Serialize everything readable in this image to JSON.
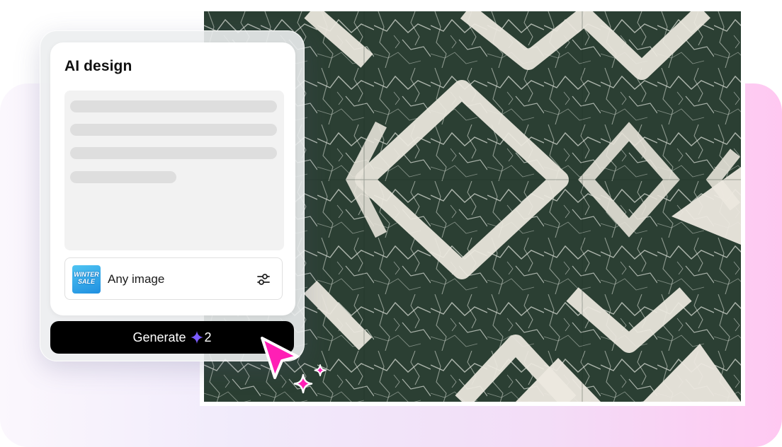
{
  "panel": {
    "title": "AI design",
    "prompt_placeholder_lines": 4,
    "image_option": {
      "thumbnail_text": "WINTER SALE",
      "label": "Any image",
      "settings_icon": "sliders-icon"
    },
    "generate_button": {
      "label": "Generate",
      "credit_icon": "sparkle-icon",
      "credit_count": "2"
    }
  },
  "preview": {
    "description_icon": "marble-pattern-image"
  },
  "colors": {
    "accent_pink": "#ff1fb5",
    "credit_purple": "#7b5cff",
    "button_black": "#000000"
  }
}
